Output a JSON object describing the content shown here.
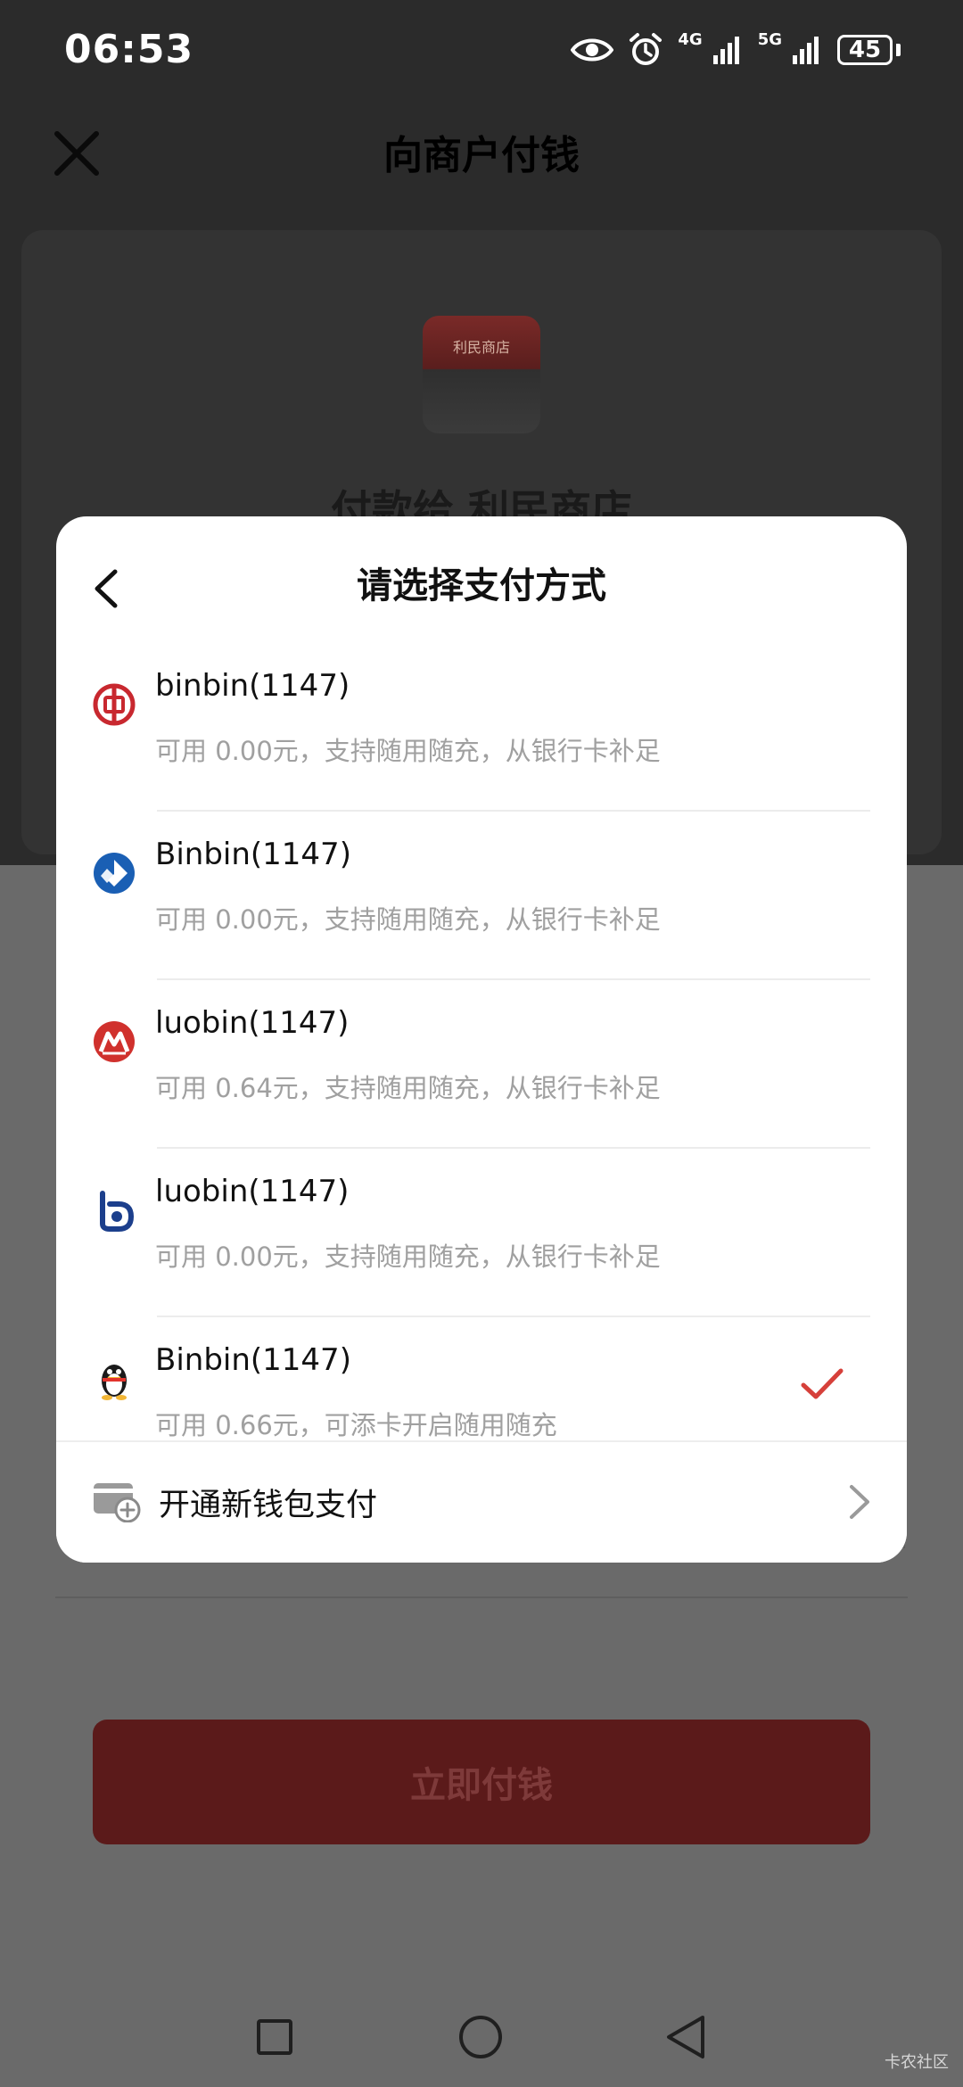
{
  "status_bar": {
    "time": "06:53",
    "network_1": "4G",
    "network_2": "5G",
    "battery": "45"
  },
  "header": {
    "title": "向商户付钱"
  },
  "merchant": {
    "thumb_label": "利民商店",
    "pay_to": "付款给 利民商店"
  },
  "pay_button": {
    "label": "立即付钱"
  },
  "modal": {
    "title": "请选择支付方式",
    "methods": [
      {
        "name": "binbin(1147)",
        "sub": "可用 0.00元，支持随用随充，从银行卡补足",
        "icon": "bank-of-china-icon",
        "color": "#c8282f"
      },
      {
        "name": "Binbin(1147)",
        "sub": "可用 0.00元，支持随用随充，从银行卡补足",
        "icon": "ccb-icon",
        "color": "#1a5fb4"
      },
      {
        "name": "luobin(1147)",
        "sub": "可用 0.64元，支持随用随充，从银行卡补足",
        "icon": "cmb-icon",
        "color": "#d0312d"
      },
      {
        "name": "luobin(1147)",
        "sub": "可用 0.00元，支持随用随充，从银行卡补足",
        "icon": "bocom-icon",
        "color": "#1c3f8c"
      },
      {
        "name": "Binbin(1147)",
        "sub": "可用 0.66元，可添卡开启随用随充",
        "icon": "qq-penguin-icon",
        "selected": true
      }
    ],
    "open_wallet": {
      "label": "开通新钱包支付"
    }
  },
  "watermark": "卡农社区",
  "colors": {
    "accent_red": "#d6403a",
    "button_dark_red": "#5b1a1a"
  }
}
